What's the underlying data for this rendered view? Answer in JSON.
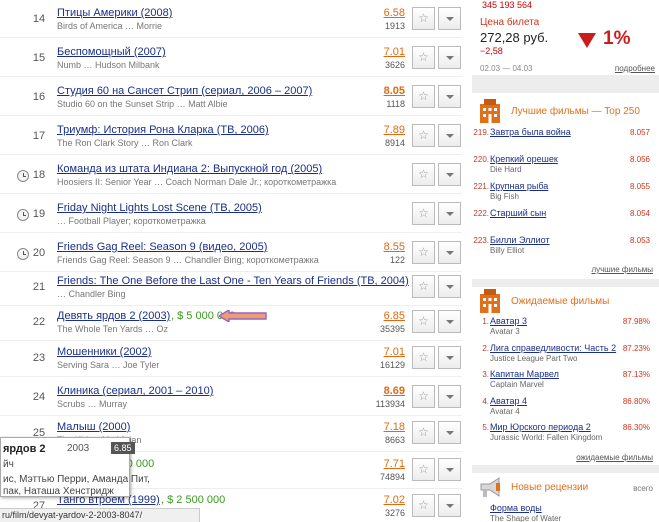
{
  "films": [
    {
      "num": "14",
      "title": "Птицы Америки (2008)",
      "money": "",
      "sub": "Birds of America … Morrie",
      "rating": "6.58",
      "votes": "1913",
      "bold": false,
      "clock": false
    },
    {
      "num": "15",
      "title": "Беспомощный (2007)",
      "money": "",
      "sub": "Numb … Hudson Milbank",
      "rating": "7.01",
      "votes": "3626",
      "bold": false,
      "clock": false
    },
    {
      "num": "16",
      "title": "Студия 60 на Сансет Стрип (сериал, 2006 – 2007)",
      "money": "",
      "sub": "Studio 60 on the Sunset Strip … Matt Albie",
      "rating": "8.05",
      "votes": "1118",
      "bold": true,
      "clock": false
    },
    {
      "num": "17",
      "title": "Триумф: История Рона Кларка (ТВ, 2006)",
      "money": "",
      "sub": "The Ron Clark Story … Ron Clark",
      "rating": "7.89",
      "votes": "8914",
      "bold": false,
      "clock": false
    },
    {
      "num": "18",
      "title": "Команда из штата Индиана 2: Выпускной год (2005)",
      "money": "",
      "sub": "Hoosiers II: Senior Year … Coach Norman Dale Jr.; короткометражка",
      "rating": "",
      "votes": "",
      "bold": false,
      "clock": true
    },
    {
      "num": "19",
      "title": "Friday Night Lights Lost Scene (ТВ, 2005)",
      "money": "",
      "sub": "… Football Player; короткометражка",
      "rating": "",
      "votes": "",
      "bold": false,
      "clock": true
    },
    {
      "num": "20",
      "title": "Friends Gag Reel: Season 9 (видео, 2005)",
      "money": "",
      "sub": "Friends Gag Reel: Season 9 … Chandler Bing; короткометражка",
      "rating": "8.55",
      "votes": "122",
      "bold": false,
      "clock": true
    },
    {
      "num": "21",
      "title": "Friends: The One Before the Last One - Ten Years of Friends (ТВ, 2004)",
      "money": "",
      "sub": "… Chandler Bing",
      "rating": "",
      "votes": "",
      "bold": false,
      "clock": false
    },
    {
      "num": "22",
      "title": "Девять ярдов 2 (2003)",
      "money": ", $ 5 000 000",
      "sub": "The Whole Ten Yards … Oz",
      "rating": "6.85",
      "votes": "35395",
      "bold": false,
      "clock": false
    },
    {
      "num": "23",
      "title": "Мошенники (2002)",
      "money": "",
      "sub": "Serving Sara … Joe Tyler",
      "rating": "7.01",
      "votes": "16129",
      "bold": false,
      "clock": false
    },
    {
      "num": "24",
      "title": "Клиника (сериал, 2001 – 2010)",
      "money": "",
      "sub": "Scrubs … Murray",
      "rating": "8.69",
      "votes": "113934",
      "bold": true,
      "clock": false
    },
    {
      "num": "25",
      "title": "Малыш (2000)",
      "money": "",
      "sub": "The Kid … Mr. Vivian",
      "rating": "7.18",
      "votes": "8663",
      "bold": false,
      "clock": false
    },
    {
      "num": "26",
      "title": "(2000)",
      "money": ", $ 3 000 000",
      "sub": "… Oz Oseransky",
      "rating": "7.71",
      "votes": "74894",
      "bold": false,
      "clock": false
    },
    {
      "num": "27",
      "title": "Танго втроем (1999)",
      "money": ", $ 2 500 000",
      "sub": "",
      "rating": "7.02",
      "votes": "3276",
      "bold": false,
      "clock": false
    }
  ],
  "popup": {
    "title": "ярдов 2",
    "year": "2003",
    "rating": "6.85",
    "line1": "йч",
    "line2": "ис, Мэттью Перри, Аманда Пит,",
    "line3": "пак, Наташа Хенстридж"
  },
  "status_bar": "ru/film/devyat-yardov-2-2003-8047/",
  "sidebar": {
    "phone": "345 193 564",
    "ticket": {
      "label": "Цена билета",
      "price": "272,28 руб.",
      "change": "−2,58",
      "percent": "1%",
      "dates": "02.03 — 04.03",
      "more": "подробнее"
    },
    "top250": {
      "title": "Лучшие фильмы — Top 250",
      "items": [
        {
          "num": "219.",
          "title": "Завтра была война",
          "sub": "",
          "val": "8.057"
        },
        {
          "num": "220.",
          "title": "Крепкий орешек",
          "sub": "Die Hard",
          "val": "8.056"
        },
        {
          "num": "221.",
          "title": "Крупная рыба",
          "sub": "Big Fish",
          "val": "8.055"
        },
        {
          "num": "222.",
          "title": "Старший сын",
          "sub": "",
          "val": "8.054"
        },
        {
          "num": "223.",
          "title": "Билли Эллиот",
          "sub": "Billy Elliot",
          "val": "8.053"
        }
      ],
      "more": "лучшие фильмы"
    },
    "expected": {
      "title": "Ожидаемые фильмы",
      "items": [
        {
          "num": "1.",
          "title": "Аватар 3",
          "sub": "Avatar 3",
          "val": "87.98%"
        },
        {
          "num": "2.",
          "title": "Лига справедливости: Часть 2",
          "sub": "Justice League Part Two",
          "val": "87.23%"
        },
        {
          "num": "3.",
          "title": "Капитан Марвел",
          "sub": "Captain Marvel",
          "val": "87.13%"
        },
        {
          "num": "4.",
          "title": "Аватар 4",
          "sub": "Avatar 4",
          "val": "86.80%"
        },
        {
          "num": "5.",
          "title": "Мир Юрского периода 2",
          "sub": "Jurassic World: Fallen Kingdom",
          "val": "86.30%"
        }
      ],
      "more": "ожидаемые фильмы"
    },
    "reviews": {
      "title": "Новые рецензии",
      "all": "всего",
      "items": [
        {
          "num": "",
          "title": "Форма воды",
          "sub": "The Shape of Water",
          "val": ""
        }
      ]
    }
  },
  "colors": {
    "accent": "#e0701a",
    "link": "#1a2f8a",
    "money": "#3a9a1e",
    "down": "#cc1d1d",
    "arrow": "#a05ec8"
  }
}
